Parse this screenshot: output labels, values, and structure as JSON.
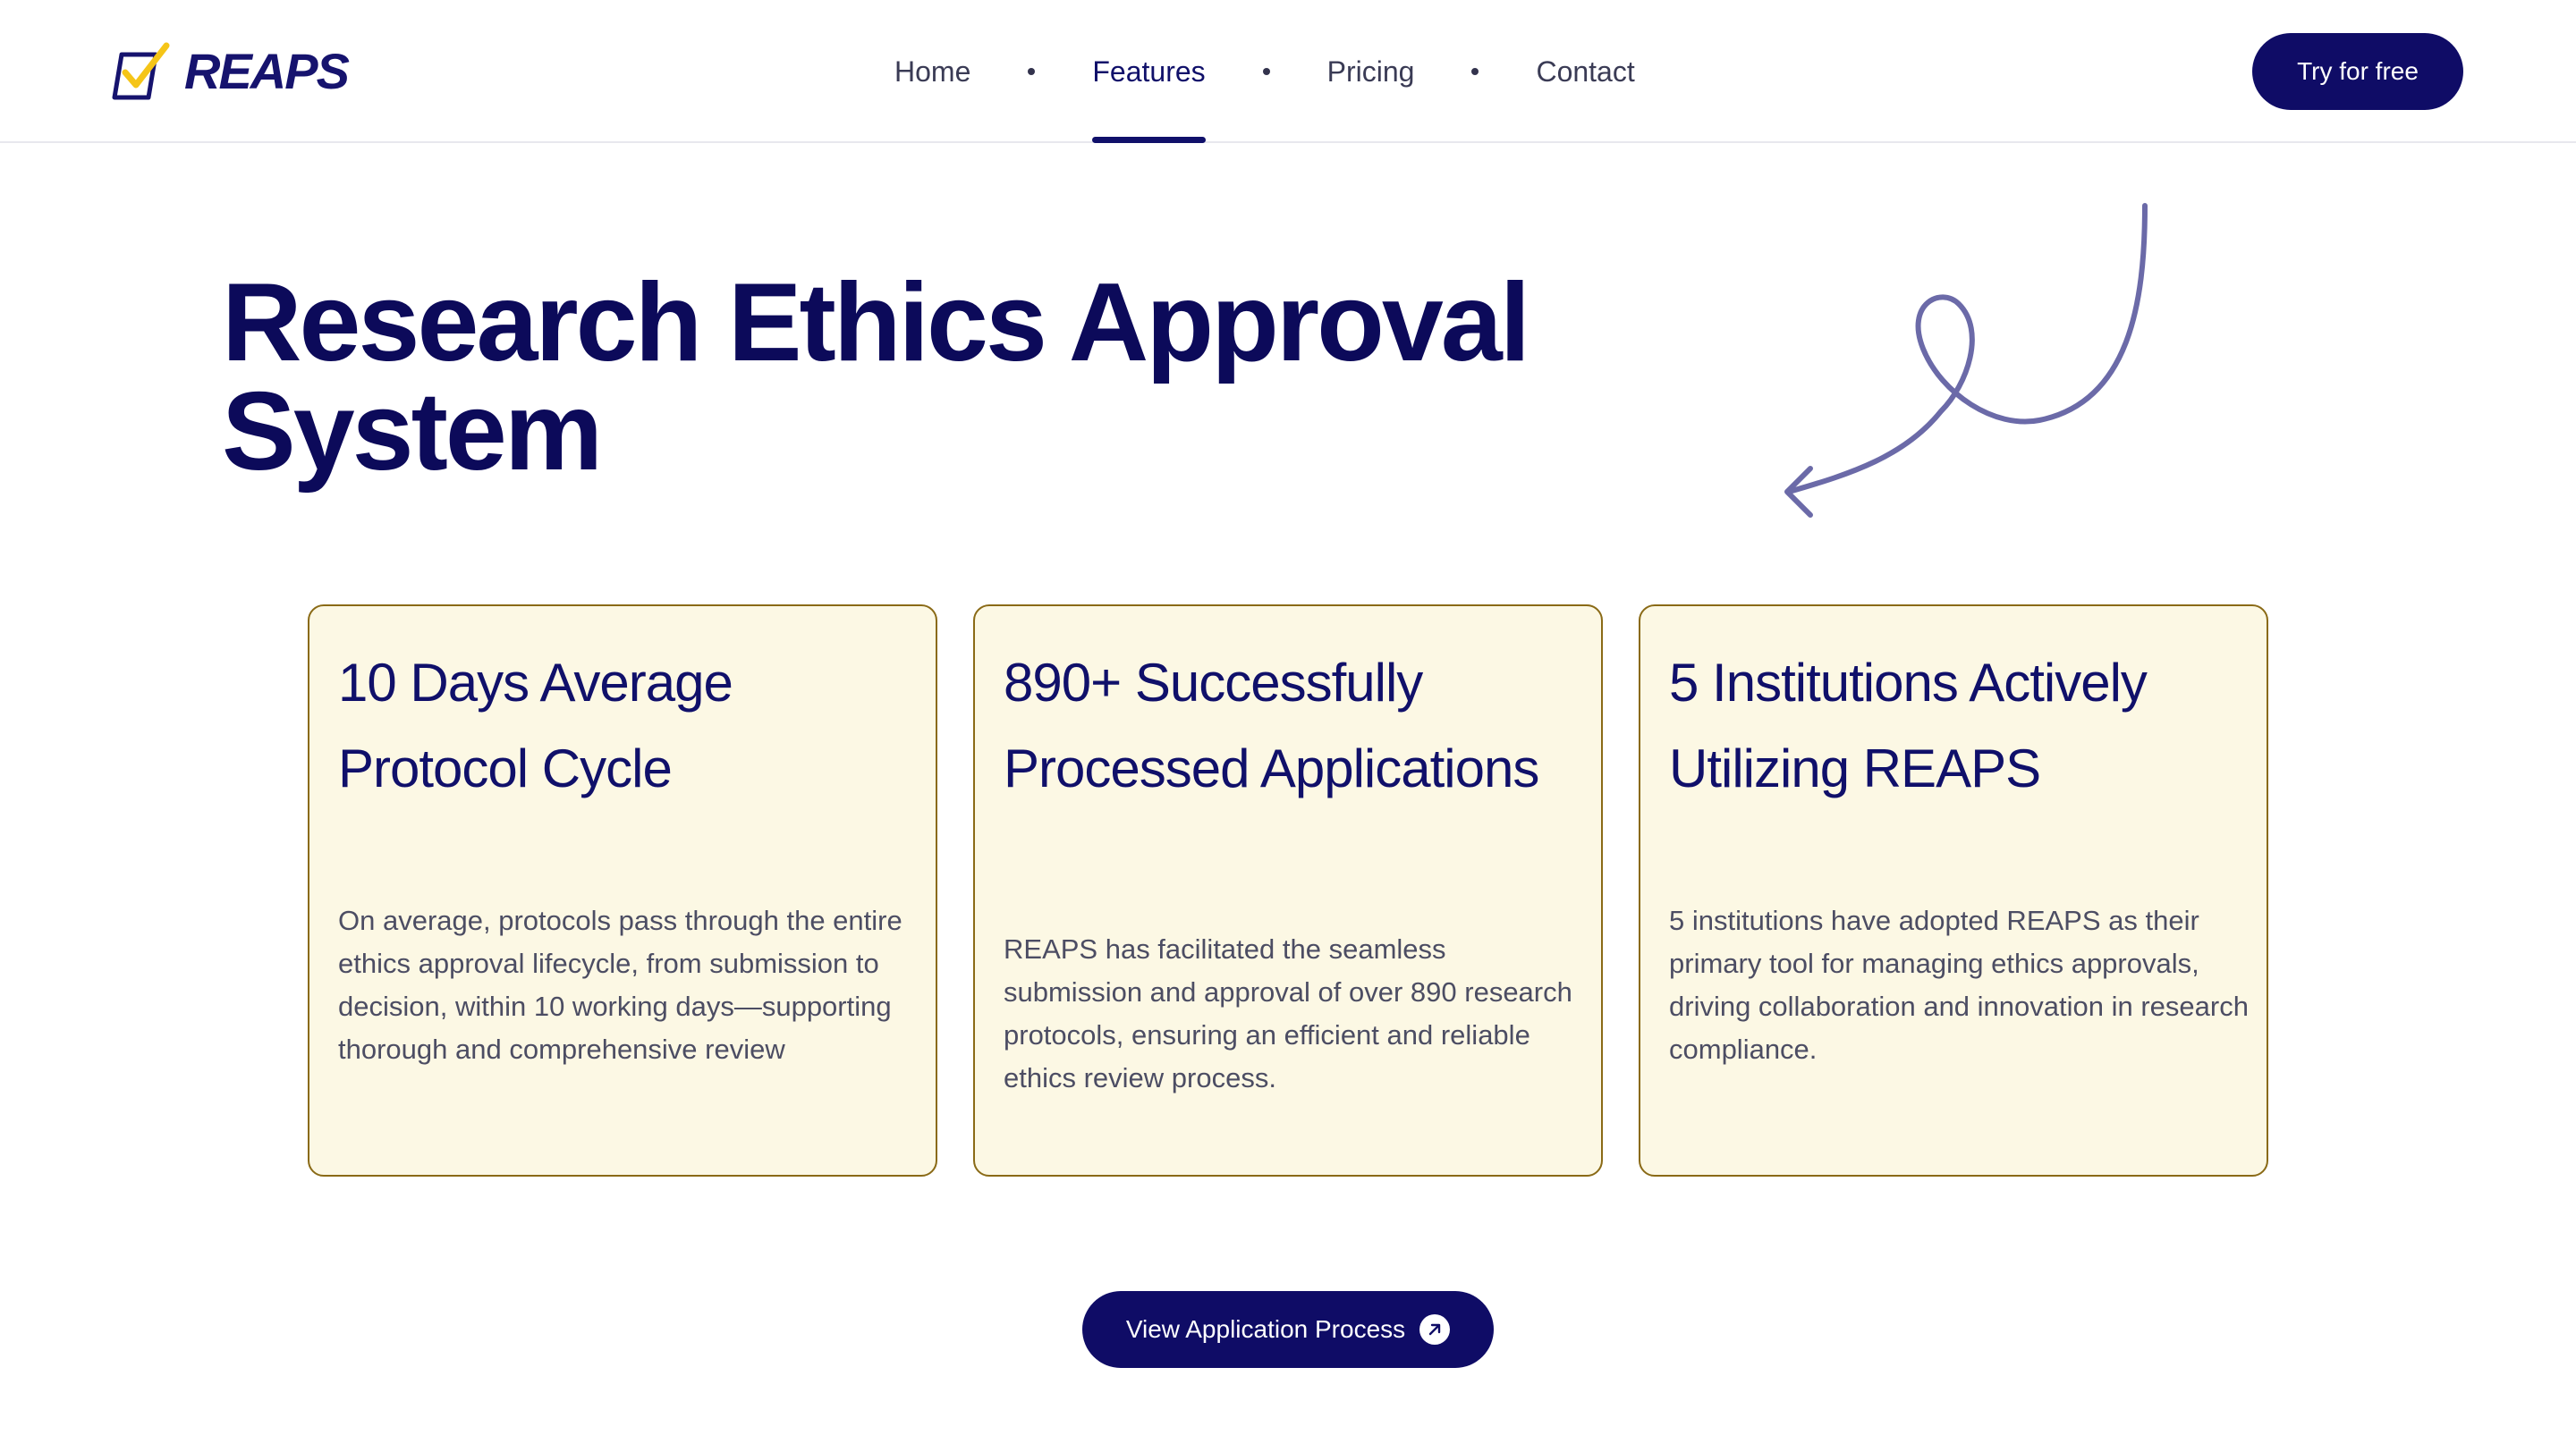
{
  "brand": {
    "name": "REAPS",
    "colors": {
      "navy": "#0f0c66",
      "yellow": "#f5c518",
      "card_bg": "#fcf8e4",
      "card_border": "#8a6a16"
    }
  },
  "nav": {
    "items": [
      {
        "label": "Home",
        "active": false
      },
      {
        "label": "Features",
        "active": true
      },
      {
        "label": "Pricing",
        "active": false
      },
      {
        "label": "Contact",
        "active": false
      }
    ],
    "cta_label": "Try for free"
  },
  "hero": {
    "title_line1": "Research Ethics Approval",
    "title_line2": "System",
    "decoration_icon": "curly-arrow-icon"
  },
  "cards": [
    {
      "title": "10 Days Average Protocol Cycle",
      "description": "On average, protocols pass through the entire ethics approval lifecycle, from submission to decision, within 10 working days—supporting thorough and comprehensive review"
    },
    {
      "title": "890+ Successfully Processed Applications",
      "description": "REAPS has facilitated the seamless submission and approval of over 890 research protocols, ensuring an efficient and reliable ethics review process."
    },
    {
      "title": "5 Institutions Actively Utilizing REAPS",
      "description": "5 institutions have adopted REAPS as their primary tool for managing ethics approvals, driving collaboration and innovation in research compliance."
    }
  ],
  "process_button": {
    "label": "View Application Process",
    "icon": "arrow-up-right-icon"
  }
}
